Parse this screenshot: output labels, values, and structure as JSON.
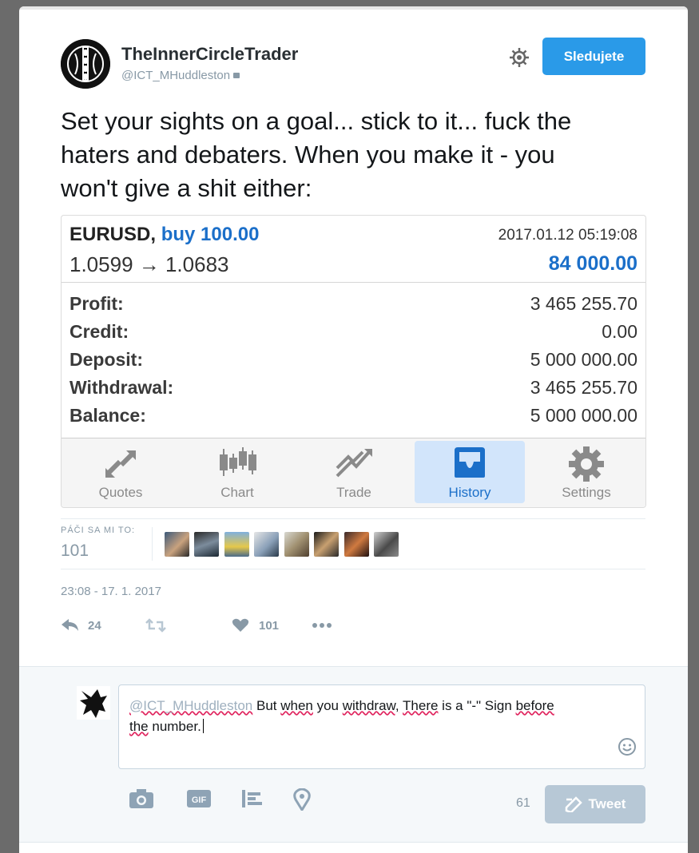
{
  "tweet": {
    "display_name": "TheInnerCircleTrader",
    "handle": "@ICT_MHuddleston",
    "follow_label": "Sledujete",
    "text": "Set your sights on a goal... stick to it... fuck the\nhaters and debaters.  When you make it - you\nwon't give a shit either:",
    "likes_label": "PÁČI SA MI TO:",
    "likes_count": "101",
    "timestamp": "23:08 - 17. 1. 2017",
    "actions": {
      "reply_count": "24",
      "retweet_count": "",
      "like_count": "101"
    }
  },
  "embed": {
    "symbol": "EURUSD,",
    "side": "buy 100.00",
    "datetime": "2017.01.12 05:19:08",
    "prices": "1.0599 → 1.0683",
    "amount": "84 000.00",
    "stats": [
      {
        "label": "Profit:",
        "value": "3 465 255.70"
      },
      {
        "label": "Credit:",
        "value": "0.00"
      },
      {
        "label": "Deposit:",
        "value": "5 000 000.00"
      },
      {
        "label": "Withdrawal:",
        "value": "3 465 255.70"
      },
      {
        "label": "Balance:",
        "value": "5 000 000.00"
      }
    ],
    "tabs": [
      "Quotes",
      "Chart",
      "Trade",
      "History",
      "Settings"
    ],
    "active_tab": "History"
  },
  "reply": {
    "mention": "@ICT_MHuddleston",
    "part1": " But ",
    "w_when": "when",
    "part2": " you ",
    "w_withdraw": "withdraw,",
    "part3": " ",
    "w_there": "There",
    "part4": " is a \"-\" Sign ",
    "w_before": "before",
    "w_the": "the",
    "part5": " number.",
    "char_count": "61",
    "tweet_label": "Tweet"
  },
  "colors": {
    "accent": "#2a9ae8",
    "mt_blue": "#1b6fc9",
    "muted": "#8899a6"
  }
}
